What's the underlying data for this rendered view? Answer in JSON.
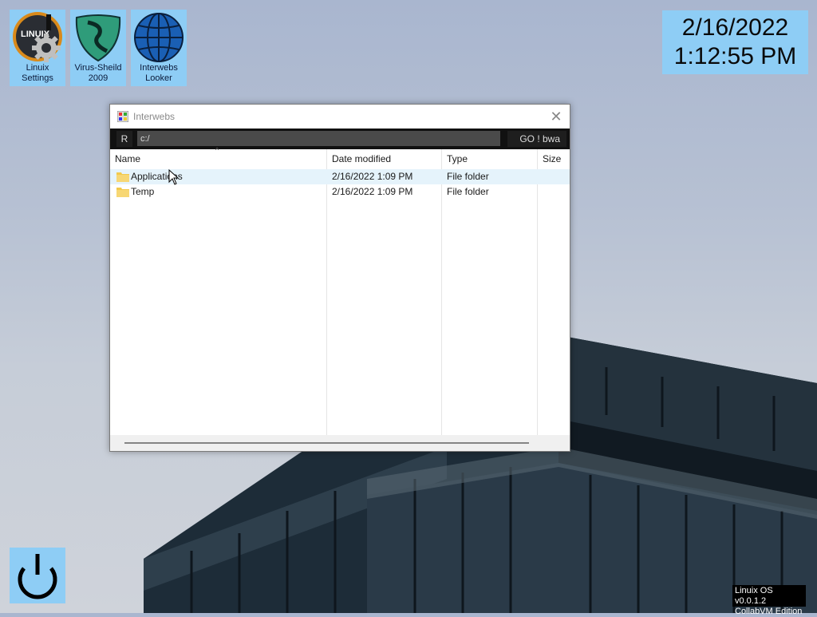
{
  "desktop": {
    "icons": [
      {
        "name": "linuix-settings",
        "label_line1": "Linuix",
        "label_line2": "Settings",
        "logo_text": "LINUIX"
      },
      {
        "name": "virus-sheild",
        "label_line1": "Virus-Sheild",
        "label_line2": "2009"
      },
      {
        "name": "interwebs-looker",
        "label_line1": "Interwebs",
        "label_line2": "Looker"
      }
    ],
    "clock": {
      "date": "2/16/2022",
      "time": "1:12:55 PM"
    },
    "version": {
      "line1": "Linuix OS v0.0.1.2",
      "line2": "CollabVM Edition"
    },
    "accent_color": "#8ecdf5"
  },
  "window": {
    "title": "Interwebs",
    "refresh_label": "R",
    "address_value": "c:/",
    "go_label": "GO ! bwa",
    "columns": [
      "Name",
      "Date modified",
      "Type",
      "Size"
    ],
    "rows": [
      {
        "name": "Applications",
        "date": "2/16/2022 1:09 PM",
        "type": "File folder",
        "size": ""
      },
      {
        "name": "Temp",
        "date": "2/16/2022 1:09 PM",
        "type": "File folder",
        "size": ""
      }
    ]
  }
}
